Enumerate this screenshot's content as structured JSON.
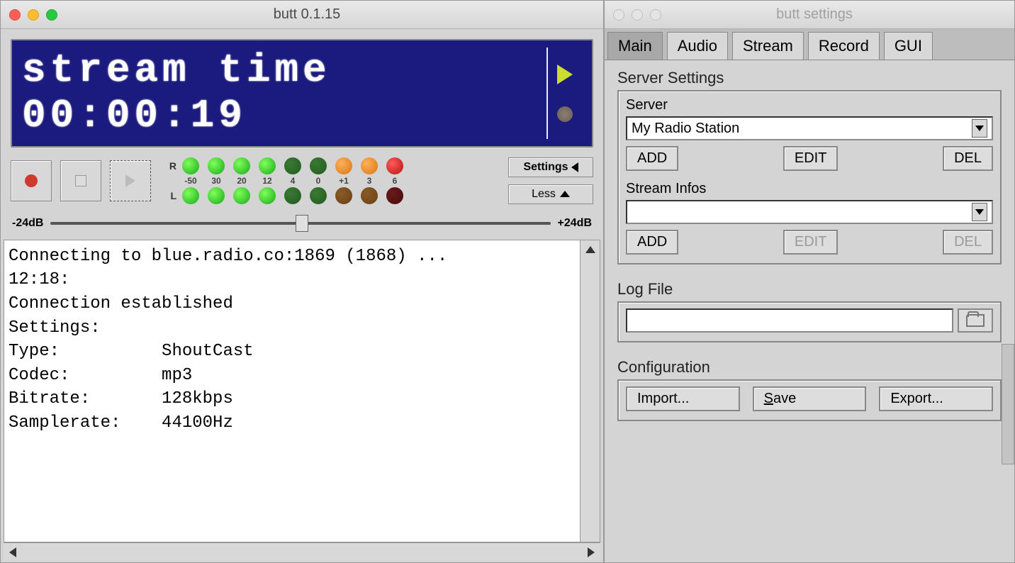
{
  "mainWindow": {
    "title": "butt 0.1.15",
    "lcd": {
      "line1": "stream time",
      "line2": "00:00:19"
    },
    "settingsBtn": "Settings",
    "lessBtn": "Less",
    "gainLow": "-24dB",
    "gainHigh": "+24dB",
    "vuTicks": [
      "-50",
      "30",
      "20",
      "12",
      "4",
      "0",
      "+1",
      "3",
      "6"
    ],
    "log": "Connecting to blue.radio.co:1869 (1868) ...\n12:18:\nConnection established\nSettings:\nType:          ShoutCast\nCodec:         mp3\nBitrate:       128kbps\nSamplerate:    44100Hz"
  },
  "settingsWindow": {
    "title": "butt settings",
    "tabs": [
      "Main",
      "Audio",
      "Stream",
      "Record",
      "GUI"
    ],
    "activeTab": "Main",
    "serverGroup": {
      "title": "Server Settings",
      "serverLabel": "Server",
      "serverValue": "My Radio Station",
      "streamLabel": "Stream Infos",
      "streamValue": "",
      "add": "ADD",
      "edit": "EDIT",
      "del": "DEL"
    },
    "logGroup": {
      "title": "Log File",
      "value": ""
    },
    "configGroup": {
      "title": "Configuration",
      "import": "Import...",
      "save": "Save",
      "export": "Export..."
    }
  }
}
